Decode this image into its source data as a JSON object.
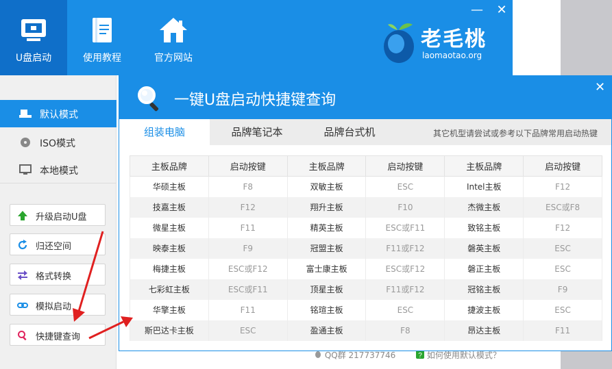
{
  "nav": [
    {
      "label": "U盘启动",
      "icon": "usb-drive-icon",
      "active": true
    },
    {
      "label": "使用教程",
      "icon": "book-icon",
      "active": false
    },
    {
      "label": "官方网站",
      "icon": "home-icon",
      "active": false
    }
  ],
  "window": {
    "minimize": "—",
    "close": "✕"
  },
  "logo": {
    "name": "老毛桃",
    "domain": "laomaotao.org"
  },
  "modes": [
    {
      "label": "默认模式",
      "icon": "usb-small-icon",
      "active": true
    },
    {
      "label": "ISO模式",
      "icon": "disc-icon",
      "active": false
    },
    {
      "label": "本地模式",
      "icon": "monitor-icon",
      "active": false
    }
  ],
  "tools": [
    {
      "label": "升级启动U盘",
      "icon": "arrow-up-icon"
    },
    {
      "label": "归还空间",
      "icon": "refresh-icon"
    },
    {
      "label": "格式转换",
      "icon": "swap-icon"
    },
    {
      "label": "模拟启动",
      "icon": "link-icon"
    },
    {
      "label": "快捷键查询",
      "icon": "search-icon"
    }
  ],
  "footer": {
    "qq": "QQ群 217737746",
    "help": "如何使用默认模式？"
  },
  "dialog": {
    "title": "一键U盘启动快捷键查询",
    "close": "✕",
    "tabs": [
      "组装电脑",
      "品牌笔记本",
      "品牌台式机"
    ],
    "note": "其它机型请尝试或参考以下品牌常用启动热键",
    "headers": [
      "主板品牌",
      "启动按键",
      "主板品牌",
      "启动按键",
      "主板品牌",
      "启动按键"
    ],
    "rows": [
      [
        "华硕主板",
        "F8",
        "双敏主板",
        "ESC",
        "Intel主板",
        "F12"
      ],
      [
        "技嘉主板",
        "F12",
        "翔升主板",
        "F10",
        "杰微主板",
        "ESC或F8"
      ],
      [
        "微星主板",
        "F11",
        "精英主板",
        "ESC或F11",
        "致铭主板",
        "F12"
      ],
      [
        "映泰主板",
        "F9",
        "冠盟主板",
        "F11或F12",
        "磐英主板",
        "ESC"
      ],
      [
        "梅捷主板",
        "ESC或F12",
        "富士康主板",
        "ESC或F12",
        "磐正主板",
        "ESC"
      ],
      [
        "七彩虹主板",
        "ESC或F11",
        "顶星主板",
        "F11或F12",
        "冠铭主板",
        "F9"
      ],
      [
        "华擎主板",
        "F11",
        "铭瑄主板",
        "ESC",
        "捷波主板",
        "ESC"
      ],
      [
        "斯巴达卡主板",
        "ESC",
        "盈通主板",
        "F8",
        "昂达主板",
        "F11"
      ]
    ]
  },
  "colors": {
    "accent": "#1a8ee6",
    "arrow": "#e02020"
  }
}
